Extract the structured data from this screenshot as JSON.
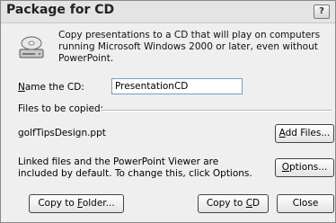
{
  "dialog": {
    "title": "Package for CD",
    "help_label": "?",
    "intro_text": "Copy presentations to a CD that will play on computers running Microsoft Windows 2000 or later, even without PowerPoint.",
    "icon": "cd-drive-icon"
  },
  "name_cd": {
    "label_prefix": "",
    "label_accel": "N",
    "label_rest": "ame the CD:",
    "value": "PresentationCD"
  },
  "files": {
    "section_label": "Files to be copied:",
    "items": [
      "golfTipsDesign.ppt"
    ],
    "note": "Linked files and the PowerPoint Viewer are included by default. To change this, click Options."
  },
  "buttons": {
    "add_files": {
      "accel": "A",
      "rest": "dd Files..."
    },
    "options": {
      "accel": "O",
      "rest": "ptions..."
    },
    "copy_folder": {
      "prefix": "Copy to ",
      "accel": "F",
      "rest": "older..."
    },
    "copy_cd": {
      "prefix": "Copy to ",
      "accel": "C",
      "rest": "D"
    },
    "close": "Close"
  }
}
